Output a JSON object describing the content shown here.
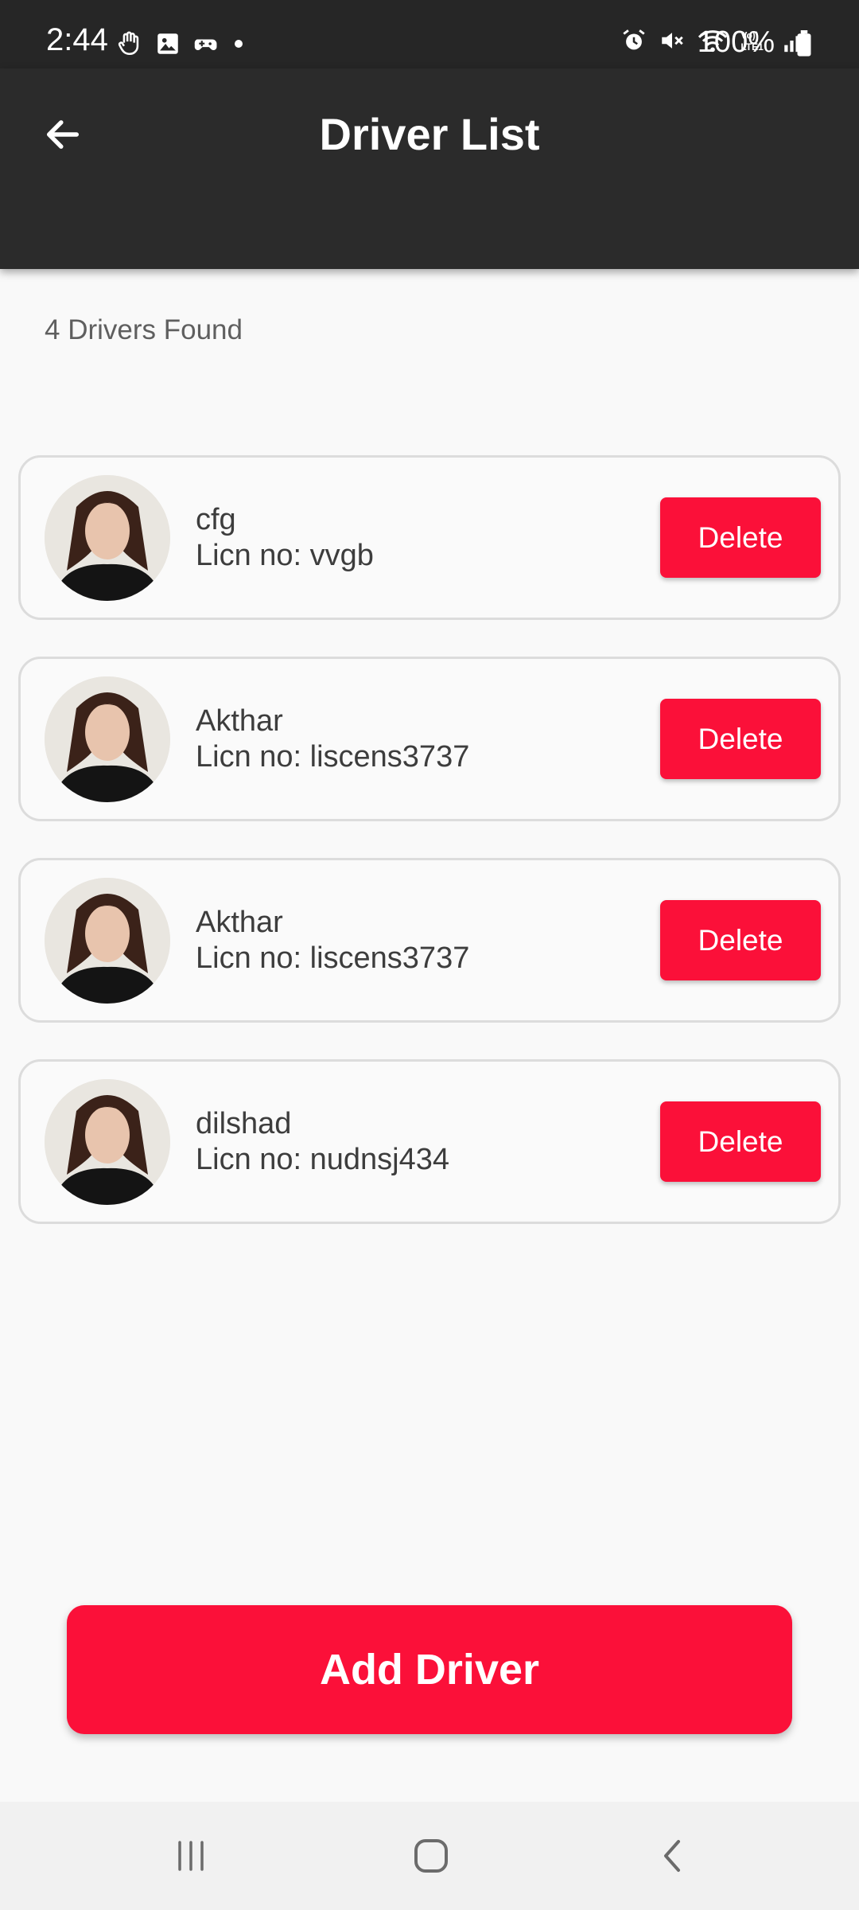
{
  "status_bar": {
    "time": "2:44",
    "battery_text": "100%",
    "left_icons": [
      "hand-icon",
      "image-icon",
      "game-icon",
      "dot-icon"
    ],
    "right_icons": [
      "alarm-icon",
      "mute-icon",
      "wifi-icon",
      "volte-icon",
      "signal-icon",
      "battery-icon"
    ]
  },
  "app_bar": {
    "title": "Driver List",
    "back_icon": "back-arrow-icon"
  },
  "summary": {
    "found_text": "4 Drivers Found"
  },
  "drivers": [
    {
      "name": "cfg",
      "license": "Licn no: vvgb",
      "delete_label": "Delete"
    },
    {
      "name": "Akthar",
      "license": "Licn no: liscens3737",
      "delete_label": "Delete"
    },
    {
      "name": "Akthar",
      "license": "Licn no: liscens3737",
      "delete_label": "Delete"
    },
    {
      "name": "dilshad",
      "license": "Licn no: nudnsj434",
      "delete_label": "Delete"
    }
  ],
  "actions": {
    "add_driver_label": "Add Driver"
  },
  "nav_bar": {
    "items": [
      "recents-icon",
      "home-icon",
      "back-icon"
    ]
  },
  "colors": {
    "accent": "#fb1039",
    "app_bar": "#2b2b2b",
    "status_bar": "#262626",
    "background": "#f9f9f9"
  }
}
